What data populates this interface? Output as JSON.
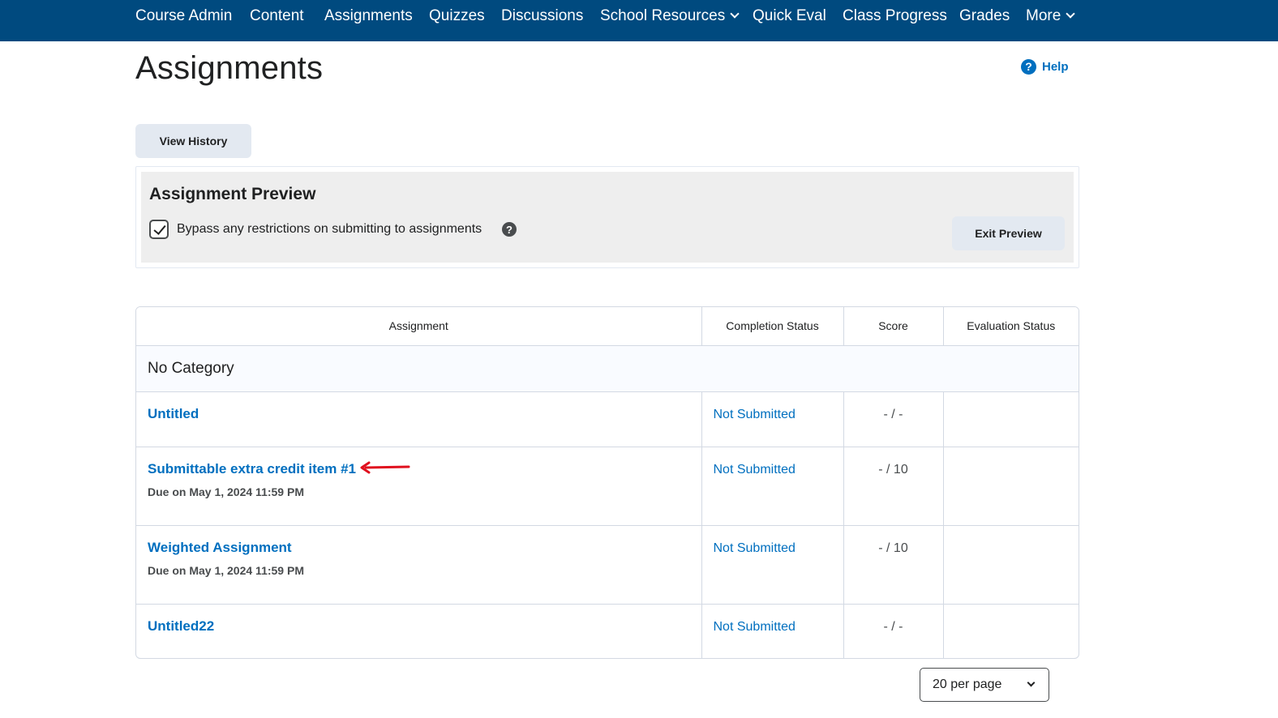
{
  "nav": {
    "items": [
      {
        "label": "Course Admin",
        "dropdown": false
      },
      {
        "label": "Content",
        "dropdown": false
      },
      {
        "label": "Assignments",
        "dropdown": false
      },
      {
        "label": "Quizzes",
        "dropdown": false
      },
      {
        "label": "Discussions",
        "dropdown": false
      },
      {
        "label": "School Resources",
        "dropdown": true
      },
      {
        "label": "Quick Eval",
        "dropdown": false
      },
      {
        "label": "Class Progress",
        "dropdown": false
      },
      {
        "label": "Grades",
        "dropdown": false
      },
      {
        "label": "More",
        "dropdown": true
      }
    ]
  },
  "page": {
    "title": "Assignments",
    "help_label": "Help",
    "view_history_label": "View History"
  },
  "preview": {
    "title": "Assignment Preview",
    "bypass_label": "Bypass any restrictions on submitting to assignments",
    "bypass_checked": true,
    "exit_label": "Exit Preview"
  },
  "table": {
    "columns": [
      "Assignment",
      "Completion Status",
      "Score",
      "Evaluation Status"
    ],
    "category": "No Category",
    "rows": [
      {
        "name": "Untitled",
        "due": "",
        "status": "Not Submitted",
        "score": "- / -",
        "evaluation": ""
      },
      {
        "name": "Submittable extra credit item #1",
        "due": "Due on May 1, 2024 11:59 PM",
        "status": "Not Submitted",
        "score": "- / 10",
        "evaluation": ""
      },
      {
        "name": "Weighted Assignment",
        "due": "Due on May 1, 2024 11:59 PM",
        "status": "Not Submitted",
        "score": "- / 10",
        "evaluation": ""
      },
      {
        "name": "Untitled22",
        "due": "",
        "status": "Not Submitted",
        "score": "- / -",
        "evaluation": ""
      }
    ]
  },
  "pager": {
    "selected": "20 per page"
  },
  "colors": {
    "nav_bg": "#004a7f",
    "link": "#006fbf",
    "annotation_arrow": "#e0101e"
  }
}
